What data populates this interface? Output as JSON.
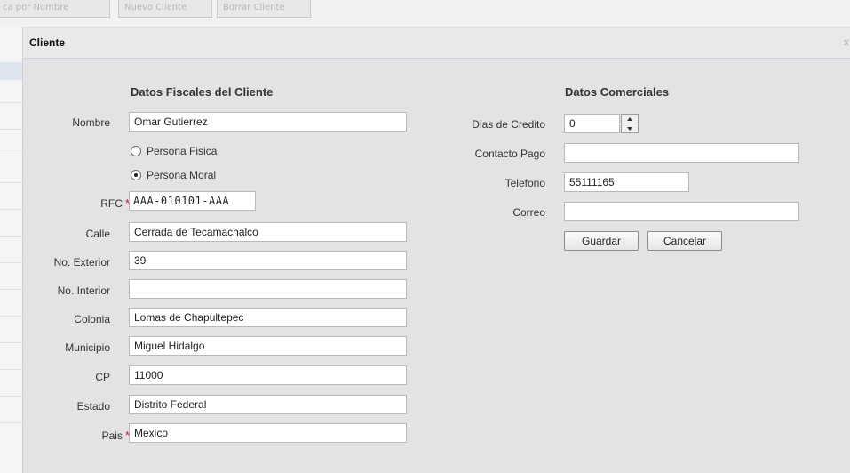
{
  "background": {
    "toolbar_buttons": [
      "ca por Nombre",
      "Nuevo Cliente",
      "Borrar Cliente"
    ]
  },
  "dialog": {
    "title": "Cliente",
    "close_label": "x"
  },
  "fiscal": {
    "section_title": "Datos Fiscales del Cliente",
    "nombre_label": "Nombre",
    "nombre_value": "Omar Gutierrez",
    "persona_fisica_label": "Persona Fisica",
    "persona_moral_label": "Persona Moral",
    "selected_persona": "moral",
    "rfc_label": "RFC",
    "rfc_value": "AAA-010101-AAA",
    "required_mark": "*",
    "calle_label": "Calle",
    "calle_value": "Cerrada de Tecamachalco",
    "no_exterior_label": "No. Exterior",
    "no_exterior_value": "39",
    "no_interior_label": "No. Interior",
    "no_interior_value": "",
    "colonia_label": "Colonia",
    "colonia_value": "Lomas de Chapultepec",
    "municipio_label": "Municipio",
    "municipio_value": "Miguel Hidalgo",
    "cp_label": "CP",
    "cp_value": "11000",
    "estado_label": "Estado",
    "estado_value": "Distrito Federal",
    "pais_label": "Pais",
    "pais_value": "Mexico"
  },
  "comercial": {
    "section_title": "Datos Comerciales",
    "dias_credito_label": "Dias de Credito",
    "dias_credito_value": "0",
    "contacto_pago_label": "Contacto Pago",
    "contacto_pago_value": "",
    "telefono_label": "Telefono",
    "telefono_value": "55111165",
    "correo_label": "Correo",
    "correo_value": "",
    "guardar_label": "Guardar",
    "cancelar_label": "Cancelar"
  },
  "colors": {
    "required": "#cc2222",
    "dialog_bg": "#e3e3e6"
  }
}
